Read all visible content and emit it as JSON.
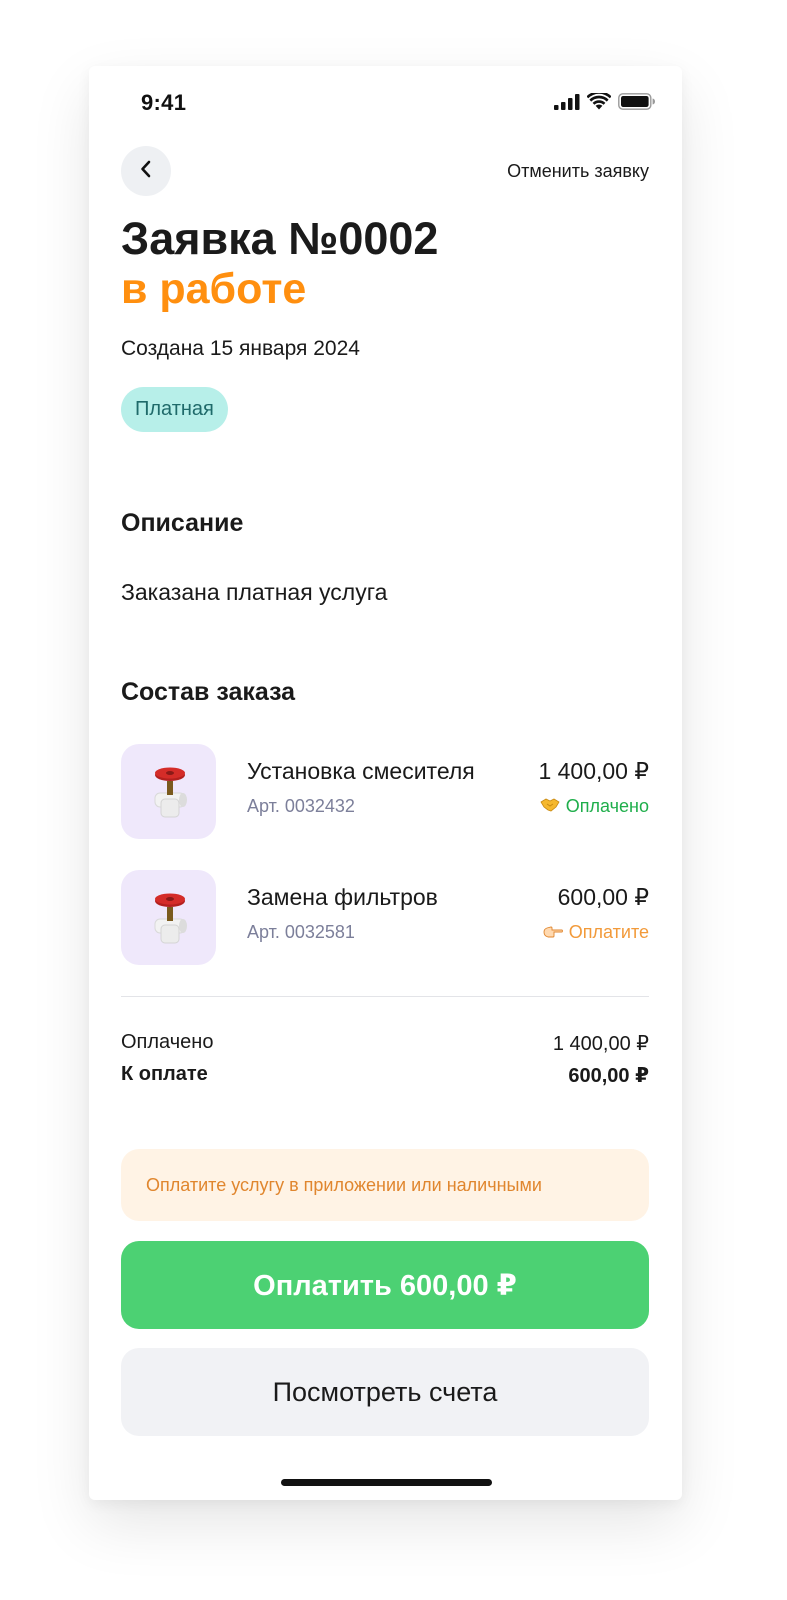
{
  "status_bar": {
    "time": "9:41",
    "icons": [
      "cellular-signal-icon",
      "wifi-icon",
      "battery-icon"
    ]
  },
  "header": {
    "back_icon": "chevron-left-icon",
    "cancel_label": "Отменить заявку"
  },
  "request": {
    "title": "Заявка №0002",
    "status": "в работе",
    "created": "Создана 15 января 2024",
    "badge": "Платная"
  },
  "description": {
    "heading": "Описание",
    "text": "Заказана платная услуга"
  },
  "order": {
    "heading": "Состав заказа",
    "items": [
      {
        "name": "Установка смесителя",
        "price": "1 400,00 ₽",
        "sku": "Арт. 0032432",
        "status": "Оплачено",
        "status_icon": "handshake-icon",
        "thumb_icon": "valve-icon"
      },
      {
        "name": "Замена фильтров",
        "price": "600,00 ₽",
        "sku": "Арт. 0032581",
        "status": "Оплатите",
        "status_icon": "pointing-hand-icon",
        "thumb_icon": "valve-icon"
      }
    ]
  },
  "summary": {
    "paid_label": "Оплачено",
    "paid_value": "1 400,00 ₽",
    "due_label": "К оплате",
    "due_value": "600,00 ₽"
  },
  "notice": "Оплатите услугу в приложении или наличными",
  "actions": {
    "pay_label": "Оплатить 600,00 ₽",
    "bills_label": "Посмотреть счета"
  },
  "colors": {
    "status_orange": "#ff8f0f",
    "badge_bg": "#b7efe9",
    "pay_green": "#4cd173",
    "paid_green": "#1fae4b",
    "topay_orange": "#f29a3a",
    "notice_bg": "#fff3e5",
    "thumb_bg": "#efe8fb"
  }
}
